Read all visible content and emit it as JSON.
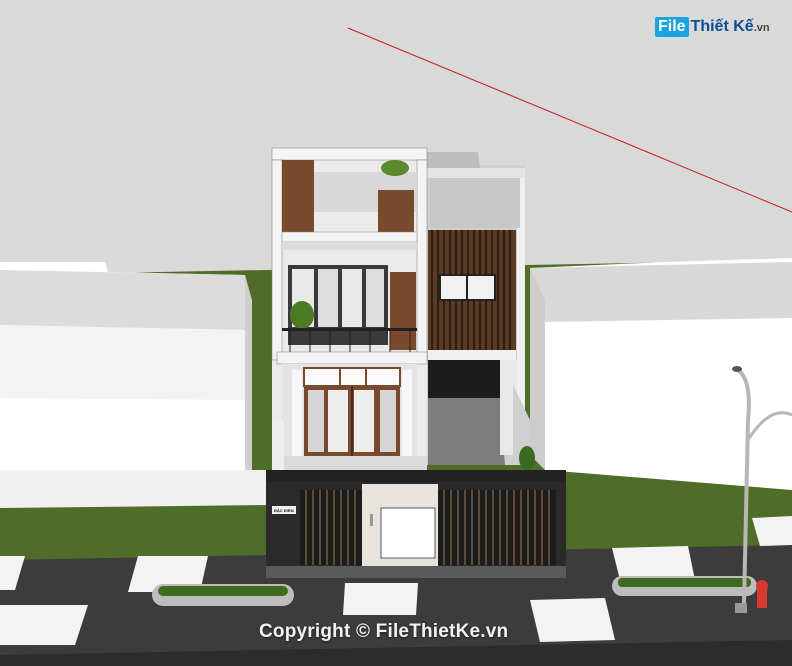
{
  "watermark": {
    "logo_mark": "File",
    "logo_text": "Thiết Kế",
    "logo_suffix": ".vn",
    "copyright": "Copyright © FileThietKe.vn"
  },
  "gate_sign": "ĐẶC ĐIỂM",
  "colors": {
    "sky": "#d9d9d9",
    "grass": "#4f6d28",
    "road": "#3c3c3c",
    "wall_white": "#ebebeb",
    "wood": "#7a4a2e",
    "red_axis": "#c81c1c"
  }
}
